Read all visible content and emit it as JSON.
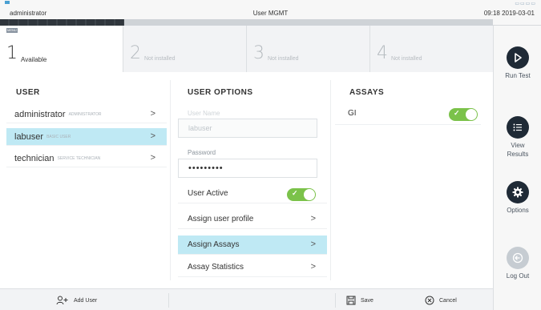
{
  "topbar": {
    "user": "administrator",
    "title": "User MGMT",
    "datetime": "09:18 2019-03-01"
  },
  "tabs": [
    {
      "number": "1",
      "status": "Available",
      "mini": "MENU"
    },
    {
      "number": "2",
      "status": "Not installed"
    },
    {
      "number": "3",
      "status": "Not installed"
    },
    {
      "number": "4",
      "status": "Not installed"
    }
  ],
  "sidebar": {
    "run_test": "Run Test",
    "view_results": "View\nResults",
    "options": "Options",
    "logout": "Log Out"
  },
  "user_panel": {
    "heading": "USER",
    "users": [
      {
        "name": "administrator",
        "role": "Administrator",
        "selected": false
      },
      {
        "name": "labuser",
        "role": "Basic user",
        "selected": true
      },
      {
        "name": "technician",
        "role": "Service technician",
        "selected": false
      }
    ]
  },
  "options_panel": {
    "heading": "USER OPTIONS",
    "username_label": "User Name",
    "username_value": "labuser",
    "password_label": "Password",
    "password_value": "•••••••••",
    "user_active_label": "User Active",
    "user_active": true,
    "items": [
      {
        "label": "Assign user profile",
        "selected": false
      },
      {
        "label": "Assign Assays",
        "selected": true
      },
      {
        "label": "Assay Statistics",
        "selected": false
      }
    ]
  },
  "assays_panel": {
    "heading": "ASSAYS",
    "assays": [
      {
        "name": "GI",
        "enabled": true
      }
    ]
  },
  "bottombar": {
    "add_user": "Add User",
    "save": "Save",
    "cancel": "Cancel"
  },
  "colors": {
    "selected_row": "#bfe9f4",
    "toggle_on": "#7bc24a",
    "sidebar_icon": "#1f2a36"
  }
}
